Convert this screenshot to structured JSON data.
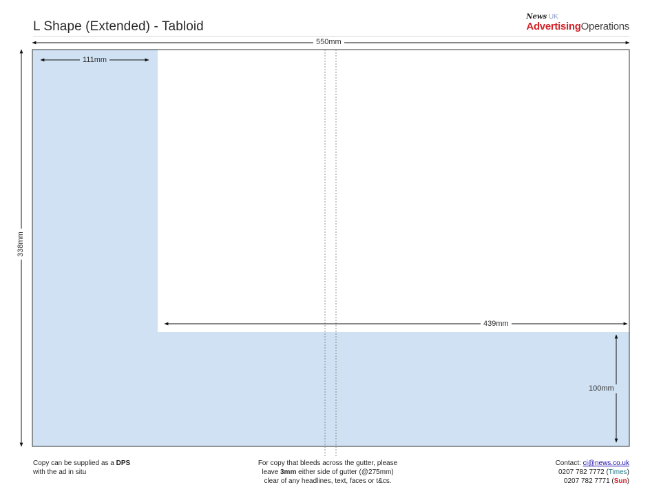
{
  "header": {
    "title": "L Shape (Extended) - Tabloid",
    "logo_news": "News",
    "logo_uk": "UK",
    "logo_advertising": "Advertising",
    "logo_operations": "Operations"
  },
  "diagram": {
    "page_width_label": "550mm",
    "page_height_label": "338mm",
    "left_column_width_label": "111mm",
    "bottom_strip_width_label": "439mm",
    "bottom_strip_height_label": "100mm",
    "ad_color": "#cfe1f2"
  },
  "footer": {
    "left_line1_prefix": "Copy can be supplied as a ",
    "left_line1_bold": "DPS",
    "left_line2": "with the ad in situ",
    "center_line1": "For copy that bleeds across the gutter, please",
    "center_line2_prefix": "leave ",
    "center_line2_bold": "3mm",
    "center_line2_suffix": " either side of gutter (@275mm)",
    "center_line3": "clear of any headlines, text, faces or t&cs.",
    "contact_label": "Contact: ",
    "contact_email": "ci@news.co.uk",
    "phone_times": "0207 782 7772 (",
    "times_label": "Times",
    "phone_sun": "0207 782 7771 (",
    "sun_label": "Sun",
    "close_paren": ")"
  }
}
